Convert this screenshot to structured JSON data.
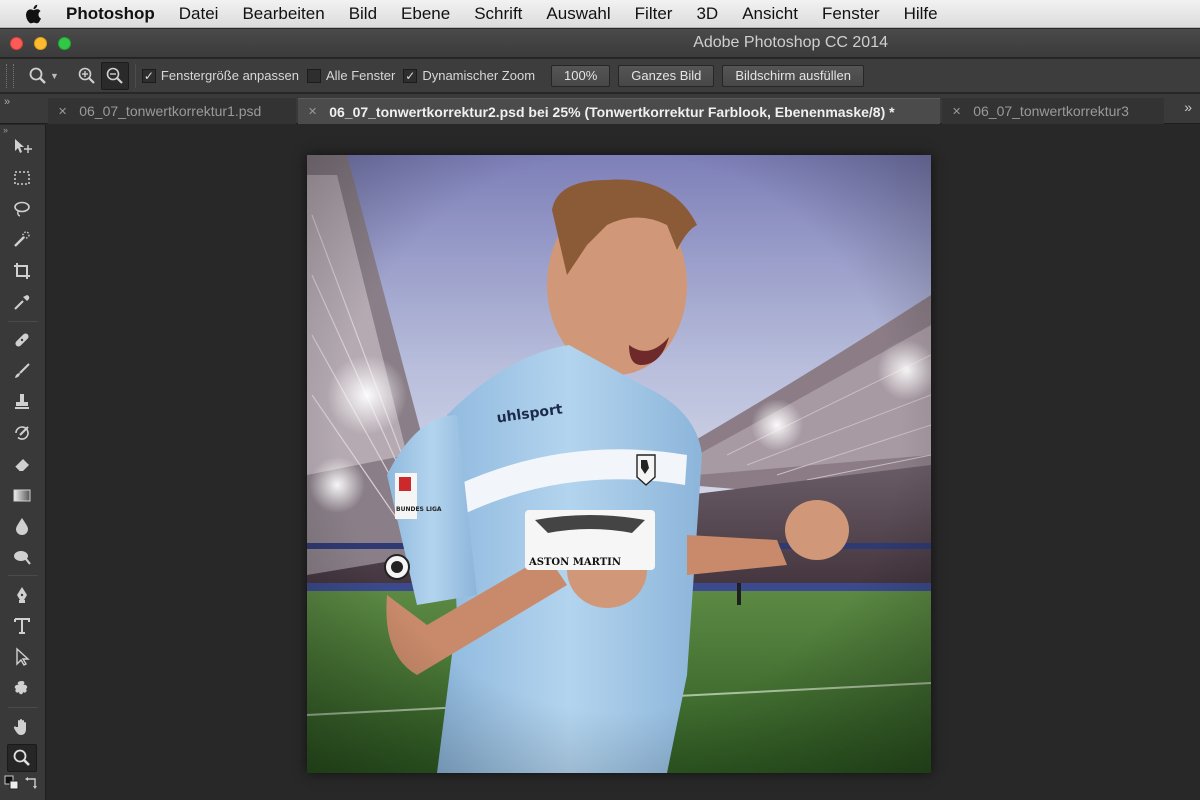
{
  "menubar": {
    "app_name": "Photoshop",
    "items": [
      "Datei",
      "Bearbeiten",
      "Bild",
      "Ebene",
      "Schrift",
      "Auswahl",
      "Filter",
      "3D",
      "Ansicht",
      "Fenster",
      "Hilfe"
    ]
  },
  "window": {
    "title": "Adobe Photoshop CC 2014"
  },
  "options": {
    "fit_window_label": "Fenstergröße anpassen",
    "fit_window_checked": true,
    "all_windows_label": "Alle Fenster",
    "all_windows_checked": false,
    "scrubby_zoom_label": "Dynamischer Zoom",
    "scrubby_zoom_checked": true,
    "btn_100": "100%",
    "btn_fit": "Ganzes Bild",
    "btn_fill": "Bildschirm ausfüllen"
  },
  "tabs": [
    {
      "label": "06_07_tonwertkorrektur1.psd",
      "active": false
    },
    {
      "label": "06_07_tonwertkorrektur2.psd bei 25% (Tonwertkorrektur Farblook, Ebenenmaske/8) *",
      "active": true
    },
    {
      "label": "06_07_tonwertkorrektur3",
      "active": false
    }
  ],
  "tabs_overflow": "»",
  "tools": [
    "move-tool",
    "marquee-tool",
    "lasso-tool",
    "quick-selection-tool",
    "crop-tool",
    "eyedropper-tool",
    "healing-brush-tool",
    "brush-tool",
    "clone-stamp-tool",
    "history-brush-tool",
    "eraser-tool",
    "gradient-tool",
    "blur-tool",
    "dodge-tool",
    "pen-tool",
    "type-tool",
    "path-selection-tool",
    "shape-tool",
    "hand-tool",
    "zoom-tool"
  ],
  "active_tool": "zoom-tool",
  "jersey": {
    "brand": "uhlsport",
    "sponsor": "ASTON MARTIN",
    "sleeve_badge": "BUNDES LIGA"
  },
  "colors": {
    "menubar_bg": "#e6e6e6",
    "ui_dark": "#3d3d3d",
    "workspace": "#282828",
    "jersey": "#a9cdea",
    "pitch": "#3f7a2e"
  }
}
